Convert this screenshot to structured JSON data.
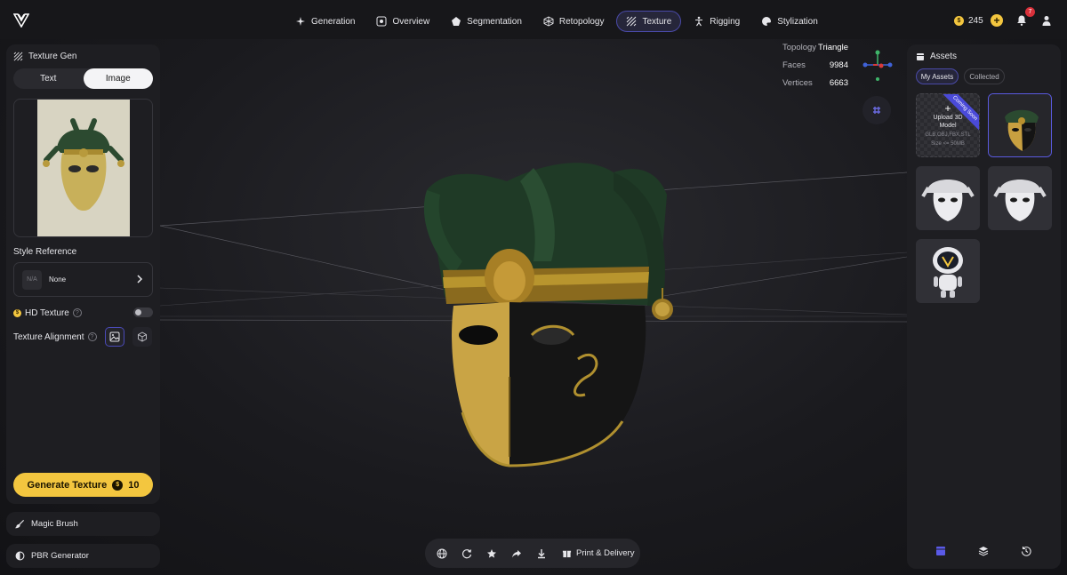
{
  "nav": {
    "items": [
      {
        "label": "Generation",
        "icon": "sparkle-icon"
      },
      {
        "label": "Overview",
        "icon": "eye-frame-icon"
      },
      {
        "label": "Segmentation",
        "icon": "segment-icon"
      },
      {
        "label": "Retopology",
        "icon": "mesh-icon"
      },
      {
        "label": "Texture",
        "icon": "texture-icon",
        "active": true
      },
      {
        "label": "Rigging",
        "icon": "figure-icon"
      },
      {
        "label": "Stylization",
        "icon": "palette-icon"
      }
    ]
  },
  "header": {
    "credits": "245",
    "notifications": "7"
  },
  "left_panel": {
    "title": "Texture Gen",
    "tabs": {
      "text": "Text",
      "image": "Image",
      "active": "Image"
    },
    "style_reference": {
      "label": "Style Reference",
      "thumb": "N/A",
      "value": "None"
    },
    "hd_texture": {
      "label": "HD Texture",
      "help": "?",
      "enabled": false
    },
    "alignment": {
      "label": "Texture Alignment",
      "help": "?"
    },
    "generate": {
      "label": "Generate Texture",
      "cost": "10"
    }
  },
  "tools": {
    "magic_brush": "Magic Brush",
    "pbr_generator": "PBR Generator"
  },
  "stats": {
    "topology_label": "Topology",
    "topology_value": "Triangle",
    "faces_label": "Faces",
    "faces_value": "9984",
    "vertices_label": "Vertices",
    "vertices_value": "6663"
  },
  "toolbar": {
    "print_label": "Print & Delivery"
  },
  "assets": {
    "title": "Assets",
    "tabs": {
      "mine": "My Assets",
      "collected": "Collected"
    },
    "upload": {
      "title_line1": "Upload 3D",
      "title_line2": "Model",
      "formats": "GLB,OBJ,FBX,STL",
      "size": "Size <= 50MB",
      "ribbon": "Coming Soon"
    }
  },
  "colors": {
    "accent": "#f3c63f",
    "selection": "#4a4aa8",
    "panel": "#1e1e22"
  }
}
